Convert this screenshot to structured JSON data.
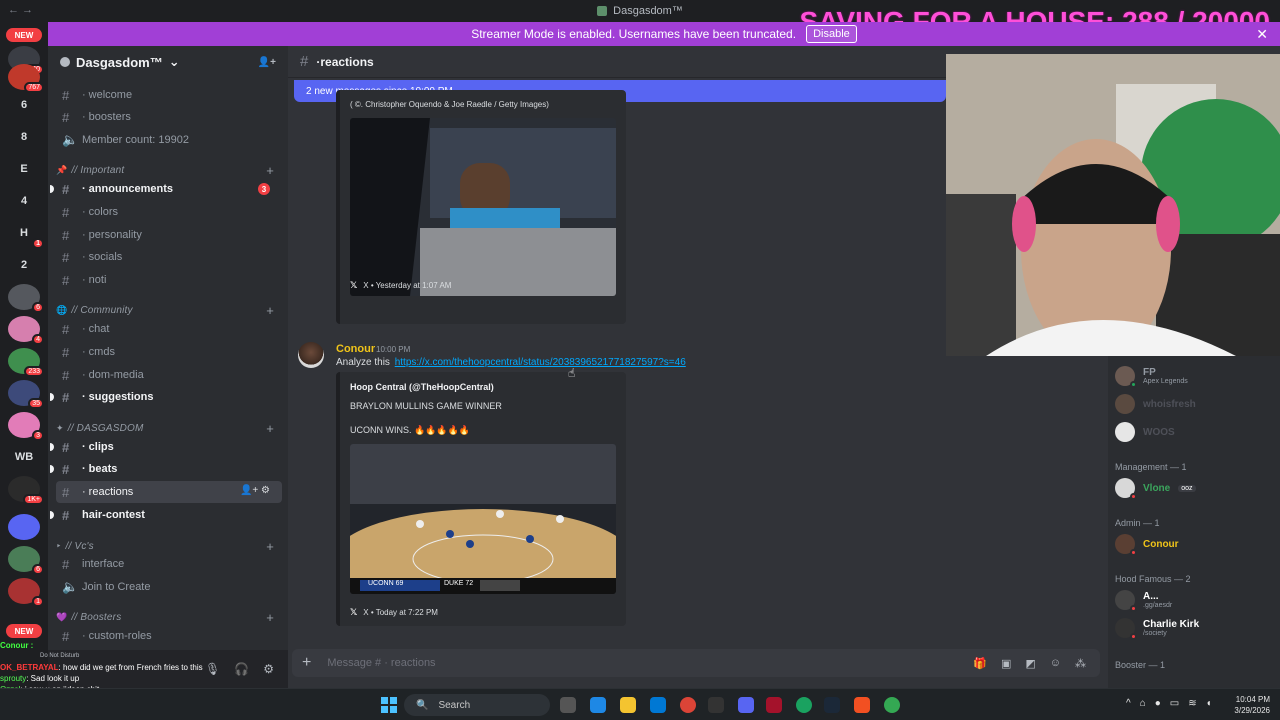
{
  "titlebar": {
    "title": "Dasgasdom™",
    "nav": "←  →"
  },
  "stream_overlay": {
    "goal": "SAVING FOR A HOUSE: 288 / 20000"
  },
  "banner": {
    "text": "Streamer Mode is enabled. Usernames have been truncated.",
    "button": "Disable",
    "close": "✕"
  },
  "rail": {
    "new_top": "NEW",
    "new_bottom": "NEW",
    "items": [
      {
        "label": "540",
        "kind": "badge"
      },
      {
        "label": "767",
        "kind": "badge"
      },
      {
        "label": "6"
      },
      {
        "label": "8"
      },
      {
        "label": "E"
      },
      {
        "label": "4"
      },
      {
        "label": "H"
      },
      {
        "label": "2"
      },
      {
        "label": "WB"
      }
    ],
    "badges": [
      "540",
      "767",
      "1",
      "6",
      "4",
      "233",
      "35",
      "3",
      "1K+",
      "6",
      "1"
    ]
  },
  "server": {
    "name": "Dasgasdom™",
    "chevron": "⌄",
    "invite_icon": "👤+"
  },
  "channels": [
    {
      "name": "welcome",
      "type": "text"
    },
    {
      "name": "boosters",
      "type": "text"
    },
    {
      "name": "Member count: 19902",
      "type": "voice"
    },
    {
      "category": "// Important"
    },
    {
      "name": "announcements",
      "type": "text",
      "unread": true,
      "badge": "3"
    },
    {
      "name": "colors",
      "type": "text"
    },
    {
      "name": "personality",
      "type": "text"
    },
    {
      "name": "socials",
      "type": "text"
    },
    {
      "name": "noti",
      "type": "text"
    },
    {
      "category": "// Community"
    },
    {
      "name": "chat",
      "type": "text"
    },
    {
      "name": "cmds",
      "type": "text"
    },
    {
      "name": "dom-media",
      "type": "text"
    },
    {
      "name": "suggestions",
      "type": "text",
      "unread": true
    },
    {
      "category": "// DASGASDOM"
    },
    {
      "name": "clips",
      "type": "text",
      "unread": true
    },
    {
      "name": "beats",
      "type": "text",
      "unread": true
    },
    {
      "name": "reactions",
      "type": "text",
      "active": true
    },
    {
      "name": "hair-contest",
      "type": "text",
      "unread": true
    },
    {
      "category": "// Vc's"
    },
    {
      "name": "interface",
      "type": "text"
    },
    {
      "name": "Join to Create",
      "type": "voice"
    },
    {
      "category": "// Boosters"
    },
    {
      "name": "custom-roles",
      "type": "text"
    }
  ],
  "chat": {
    "channel": "reactions",
    "new_messages": "2 new messages since 10:00 PM",
    "top_caption": "( ©. Christopher Oquendo & Joe Raedle / Getty Images)",
    "embed1_footer": "X • Yesterday at 1:07 AM",
    "message": {
      "author": "Conour",
      "time": "10:00 PM",
      "prefix": "Analyze this",
      "link": "https://x.com/thehoopcentral/status/2038396521771827597?s=46"
    },
    "embed2": {
      "author": "Hoop Central (@TheHoopCentral)",
      "line1": "BRAYLON MULLINS GAME WINNER",
      "line2": "UCONN WINS. 🔥🔥🔥🔥🔥",
      "footer": "X • Today at 7:22 PM",
      "score_home": "UCONN 69",
      "score_away": "DUKE 72"
    },
    "composer_placeholder": "Message # · reactions"
  },
  "members": {
    "top_items": [
      {
        "name": "FP",
        "sub": "Apex Legends"
      },
      {
        "name": "whoisfresh"
      },
      {
        "name": "WOOS"
      }
    ],
    "groups": [
      {
        "title": "Management — 1",
        "members": [
          {
            "name": "Vlone",
            "tag": "ooz",
            "color": "#3ba55d"
          }
        ]
      },
      {
        "title": "Admin — 1",
        "members": [
          {
            "name": "Conour",
            "color": "#f0c419"
          }
        ]
      },
      {
        "title": "Hood Famous — 2",
        "members": [
          {
            "name": "A...",
            "sub": ".gg/aesdr",
            "color": "#ffffff"
          },
          {
            "name": "Charlie Kirk",
            "sub": "/society",
            "color": "#ffffff"
          }
        ]
      },
      {
        "title": "Booster — 1",
        "members": []
      }
    ]
  },
  "user_panel": {
    "status": "Do Not Disturb",
    "name": "Conour : Dasg"
  },
  "overlay_chat": [
    {
      "user": "Conour :",
      "text": ""
    },
    {
      "user": "OK_BETRAYAL",
      "text": ": how did we get from French fries to this"
    },
    {
      "user": "sprouty",
      "text": ": Sad look it up"
    },
    {
      "user": "Ozzal",
      "text": ": i saw u on jideon chit"
    }
  ],
  "taskbar": {
    "search": "Search",
    "time": "10:04 PM",
    "date": "3/29/2026"
  }
}
